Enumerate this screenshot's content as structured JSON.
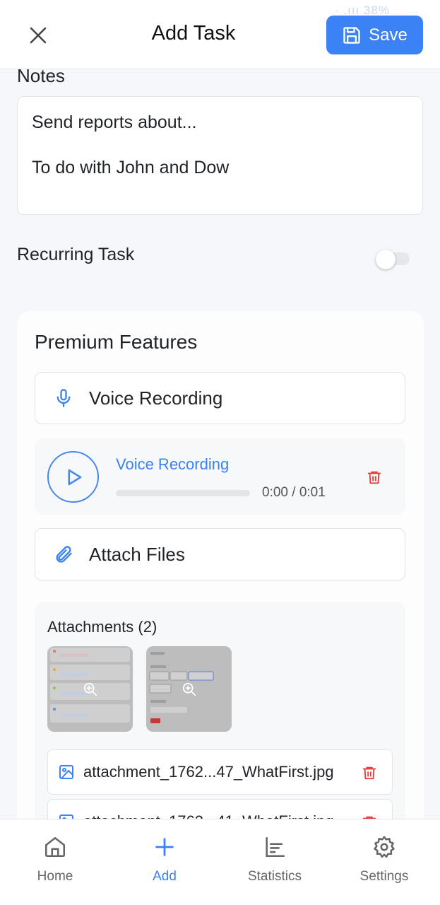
{
  "header": {
    "title": "Add Task",
    "save_label": "Save",
    "status_fragment": "· .ııı 38%"
  },
  "notes": {
    "label": "Notes",
    "line1": "Send reports about...",
    "line2": "To do with John and Dow"
  },
  "recurring": {
    "label": "Recurring Task",
    "enabled": false
  },
  "premium": {
    "title": "Premium Features",
    "voice_button_label": "Voice Recording",
    "player": {
      "title": "Voice Recording",
      "time": "0:00 / 0:01",
      "progress": 0
    },
    "attach_button_label": "Attach Files",
    "attachments": {
      "title": "Attachments (2)",
      "files": [
        {
          "name": "attachment_1762...47_WhatFirst.jpg"
        },
        {
          "name": "attachment_1762...41_WhatFirst.jpg"
        }
      ]
    }
  },
  "nav": {
    "items": [
      {
        "label": "Home",
        "icon": "home-icon"
      },
      {
        "label": "Add",
        "icon": "plus-icon",
        "active": true
      },
      {
        "label": "Statistics",
        "icon": "bar-chart-icon"
      },
      {
        "label": "Settings",
        "icon": "gear-icon"
      }
    ]
  },
  "colors": {
    "accent": "#3b82f6",
    "danger": "#e53935"
  }
}
